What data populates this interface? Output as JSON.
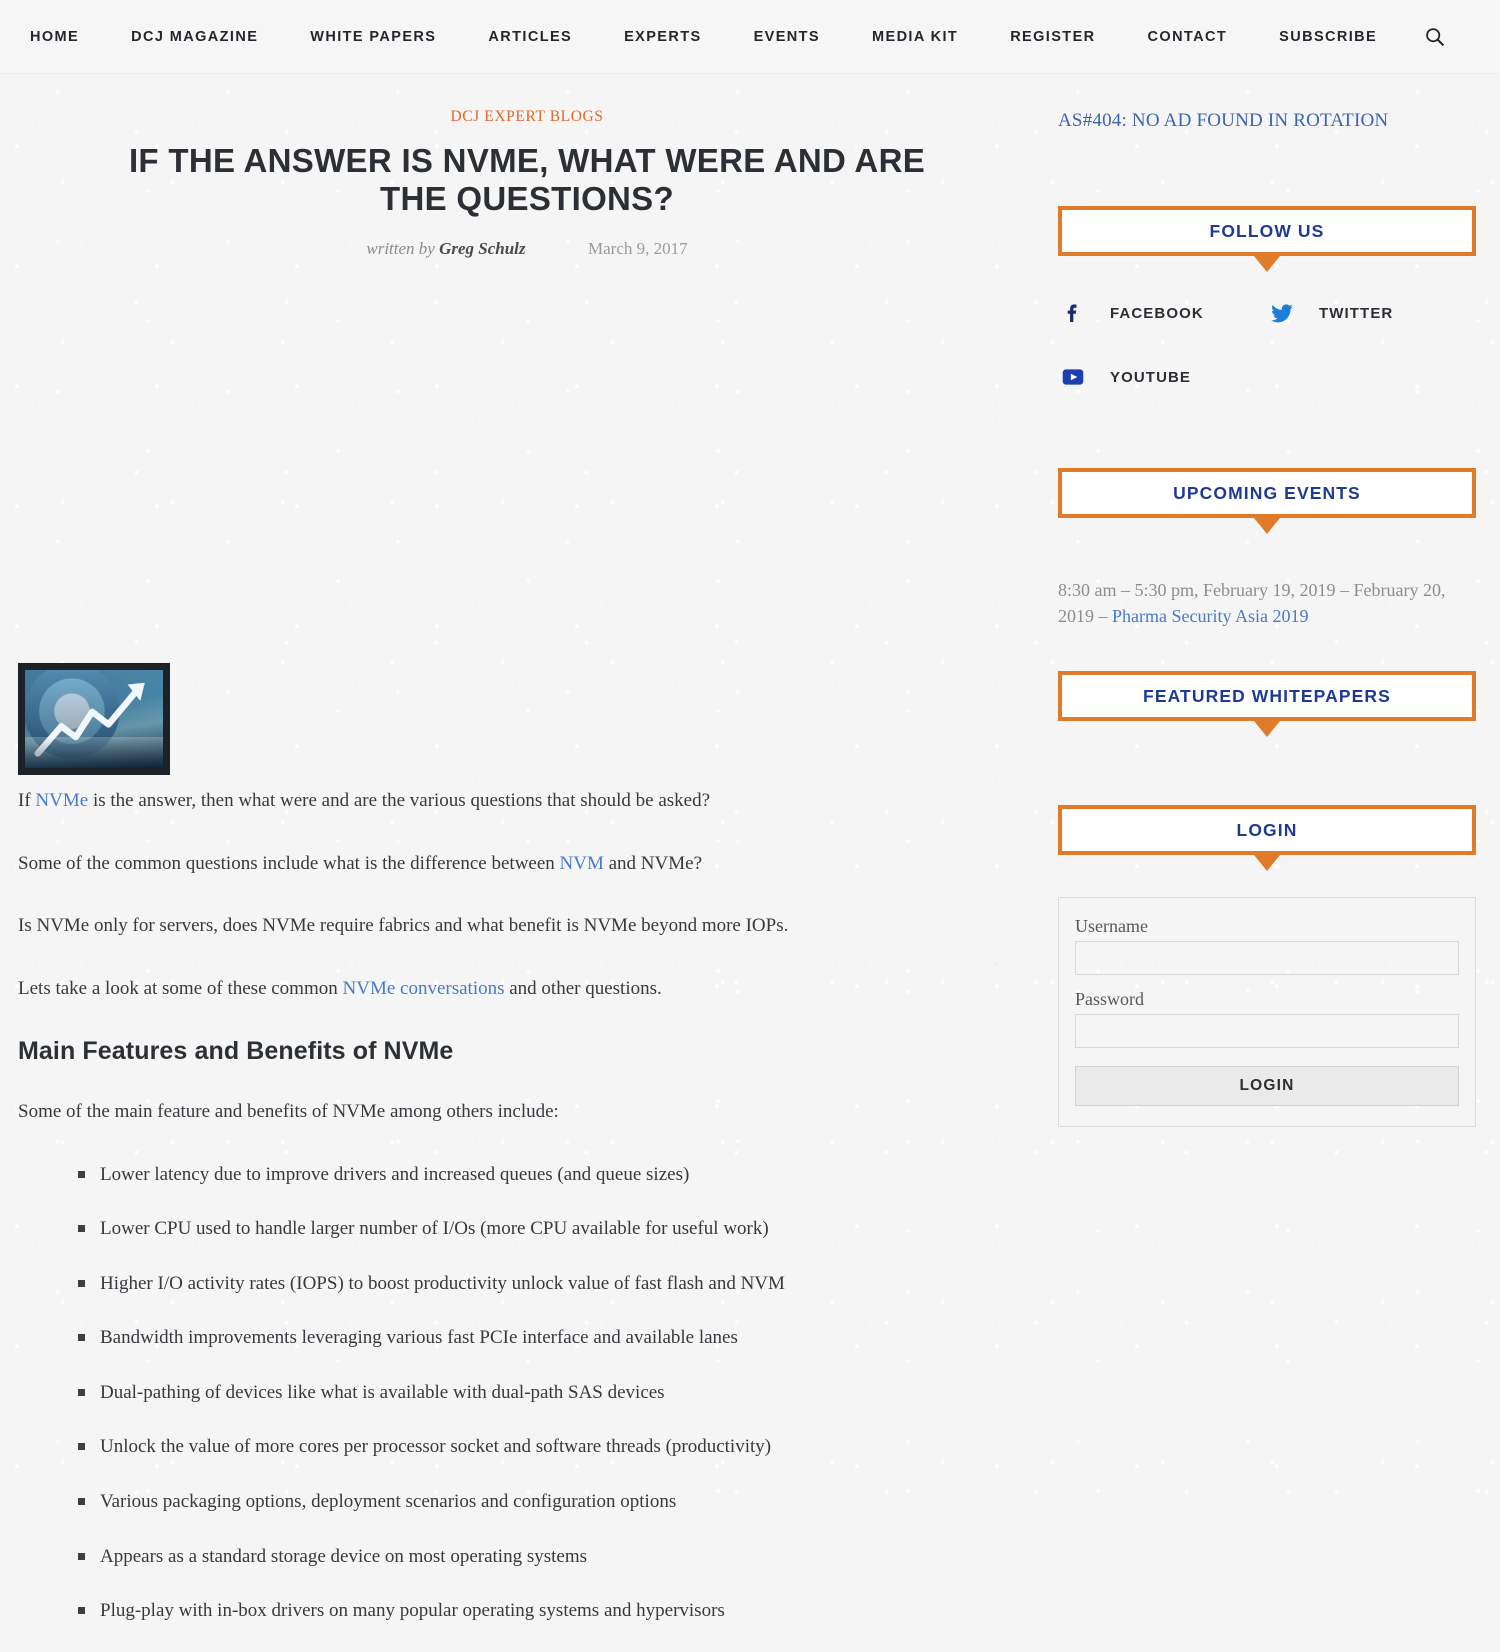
{
  "nav": {
    "items": [
      {
        "label": "HOME"
      },
      {
        "label": "DCJ MAGAZINE"
      },
      {
        "label": "WHITE PAPERS"
      },
      {
        "label": "ARTICLES"
      },
      {
        "label": "EXPERTS"
      },
      {
        "label": "EVENTS"
      },
      {
        "label": "MEDIA KIT"
      },
      {
        "label": "REGISTER"
      },
      {
        "label": "CONTACT"
      },
      {
        "label": "SUBSCRIBE"
      }
    ],
    "search_icon": "search-icon"
  },
  "article": {
    "category": "DCJ EXPERT BLOGS",
    "title": "IF THE ANSWER IS NVME, WHAT WERE AND ARE THE QUESTIONS?",
    "written_by_label": "written by",
    "author": "Greg Schulz",
    "date": "March 9, 2017",
    "paragraphs": [
      {
        "parts": [
          {
            "text": "If ",
            "link": false
          },
          {
            "text": "NVMe",
            "link": true
          },
          {
            "text": " is the answer, then what were and are the various questions that should be asked?",
            "link": false
          }
        ]
      },
      {
        "parts": [
          {
            "text": "Some of the common questions include what is the difference between ",
            "link": false
          },
          {
            "text": "NVM",
            "link": true
          },
          {
            "text": " and NVMe?",
            "link": false
          }
        ]
      },
      {
        "parts": [
          {
            "text": "Is NVMe only for servers, does NVMe require fabrics and what benefit is NVMe beyond more IOPs.",
            "link": false
          }
        ]
      },
      {
        "parts": [
          {
            "text": "Lets take a look at some of these common ",
            "link": false
          },
          {
            "text": "NVMe conversations",
            "link": true
          },
          {
            "text": " and other questions.",
            "link": false
          }
        ]
      }
    ],
    "section_heading": "Main Features and Benefits of NVMe",
    "list_intro": "Some of the main feature and benefits of NVMe among others include:",
    "features": [
      "Lower latency due to improve drivers and increased queues (and queue sizes)",
      "Lower CPU used to handle larger number of I/Os (more CPU available for useful work)",
      "Higher I/O activity rates (IOPS) to boost productivity unlock value of fast flash and NVM",
      "Bandwidth improvements leveraging various fast PCIe interface and available lanes",
      "Dual-pathing of devices like what is available with dual-path SAS devices",
      "Unlock the value of more cores per processor socket and software threads (productivity)",
      "Various packaging options, deployment scenarios and configuration options",
      "Appears as a standard storage device on most operating systems",
      "Plug-play with in-box drivers on many popular operating systems and hypervisors"
    ]
  },
  "sidebar": {
    "ad_notice": "AS#404: NO AD FOUND IN ROTATION",
    "follow_us": {
      "title": "FOLLOW US",
      "socials": [
        {
          "label": "FACEBOOK",
          "icon": "facebook-icon"
        },
        {
          "label": "TWITTER",
          "icon": "twitter-icon"
        },
        {
          "label": "YOUTUBE",
          "icon": "youtube-icon"
        }
      ]
    },
    "upcoming_events": {
      "title": "UPCOMING EVENTS",
      "event_time": "8:30 am – 5:30 pm, February 19, 2019 – February 20, 2019 – ",
      "event_name": "Pharma Security Asia 2019"
    },
    "featured_whitepapers": {
      "title": "FEATURED WHITEPAPERS"
    },
    "login": {
      "title": "LOGIN",
      "username_label": "Username",
      "username_value": "",
      "password_label": "Password",
      "password_value": "",
      "submit_label": "LOGIN"
    }
  },
  "colors": {
    "accent_orange": "#e07b2a",
    "category_orange": "#e2682a",
    "link_blue": "#4a79c9",
    "heading_blue": "#1f3a93",
    "text_dark": "#36393d",
    "page_bg": "#f5f5f5"
  }
}
